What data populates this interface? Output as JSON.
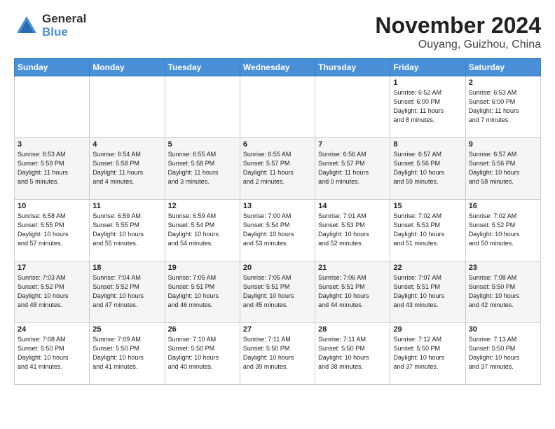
{
  "logo": {
    "general": "General",
    "blue": "Blue"
  },
  "title": "November 2024",
  "subtitle": "Ouyang, Guizhou, China",
  "header_days": [
    "Sunday",
    "Monday",
    "Tuesday",
    "Wednesday",
    "Thursday",
    "Friday",
    "Saturday"
  ],
  "weeks": [
    [
      {
        "day": "",
        "info": ""
      },
      {
        "day": "",
        "info": ""
      },
      {
        "day": "",
        "info": ""
      },
      {
        "day": "",
        "info": ""
      },
      {
        "day": "",
        "info": ""
      },
      {
        "day": "1",
        "info": "Sunrise: 6:52 AM\nSunset: 6:00 PM\nDaylight: 11 hours\nand 8 minutes."
      },
      {
        "day": "2",
        "info": "Sunrise: 6:53 AM\nSunset: 6:00 PM\nDaylight: 11 hours\nand 7 minutes."
      }
    ],
    [
      {
        "day": "3",
        "info": "Sunrise: 6:53 AM\nSunset: 5:59 PM\nDaylight: 11 hours\nand 5 minutes."
      },
      {
        "day": "4",
        "info": "Sunrise: 6:54 AM\nSunset: 5:58 PM\nDaylight: 11 hours\nand 4 minutes."
      },
      {
        "day": "5",
        "info": "Sunrise: 6:55 AM\nSunset: 5:58 PM\nDaylight: 11 hours\nand 3 minutes."
      },
      {
        "day": "6",
        "info": "Sunrise: 6:55 AM\nSunset: 5:57 PM\nDaylight: 11 hours\nand 2 minutes."
      },
      {
        "day": "7",
        "info": "Sunrise: 6:56 AM\nSunset: 5:57 PM\nDaylight: 11 hours\nand 0 minutes."
      },
      {
        "day": "8",
        "info": "Sunrise: 6:57 AM\nSunset: 5:56 PM\nDaylight: 10 hours\nand 59 minutes."
      },
      {
        "day": "9",
        "info": "Sunrise: 6:57 AM\nSunset: 5:56 PM\nDaylight: 10 hours\nand 58 minutes."
      }
    ],
    [
      {
        "day": "10",
        "info": "Sunrise: 6:58 AM\nSunset: 5:55 PM\nDaylight: 10 hours\nand 57 minutes."
      },
      {
        "day": "11",
        "info": "Sunrise: 6:59 AM\nSunset: 5:55 PM\nDaylight: 10 hours\nand 55 minutes."
      },
      {
        "day": "12",
        "info": "Sunrise: 6:59 AM\nSunset: 5:54 PM\nDaylight: 10 hours\nand 54 minutes."
      },
      {
        "day": "13",
        "info": "Sunrise: 7:00 AM\nSunset: 5:54 PM\nDaylight: 10 hours\nand 53 minutes."
      },
      {
        "day": "14",
        "info": "Sunrise: 7:01 AM\nSunset: 5:53 PM\nDaylight: 10 hours\nand 52 minutes."
      },
      {
        "day": "15",
        "info": "Sunrise: 7:02 AM\nSunset: 5:53 PM\nDaylight: 10 hours\nand 51 minutes."
      },
      {
        "day": "16",
        "info": "Sunrise: 7:02 AM\nSunset: 5:52 PM\nDaylight: 10 hours\nand 50 minutes."
      }
    ],
    [
      {
        "day": "17",
        "info": "Sunrise: 7:03 AM\nSunset: 5:52 PM\nDaylight: 10 hours\nand 48 minutes."
      },
      {
        "day": "18",
        "info": "Sunrise: 7:04 AM\nSunset: 5:52 PM\nDaylight: 10 hours\nand 47 minutes."
      },
      {
        "day": "19",
        "info": "Sunrise: 7:05 AM\nSunset: 5:51 PM\nDaylight: 10 hours\nand 46 minutes."
      },
      {
        "day": "20",
        "info": "Sunrise: 7:05 AM\nSunset: 5:51 PM\nDaylight: 10 hours\nand 45 minutes."
      },
      {
        "day": "21",
        "info": "Sunrise: 7:06 AM\nSunset: 5:51 PM\nDaylight: 10 hours\nand 44 minutes."
      },
      {
        "day": "22",
        "info": "Sunrise: 7:07 AM\nSunset: 5:51 PM\nDaylight: 10 hours\nand 43 minutes."
      },
      {
        "day": "23",
        "info": "Sunrise: 7:08 AM\nSunset: 5:50 PM\nDaylight: 10 hours\nand 42 minutes."
      }
    ],
    [
      {
        "day": "24",
        "info": "Sunrise: 7:08 AM\nSunset: 5:50 PM\nDaylight: 10 hours\nand 41 minutes."
      },
      {
        "day": "25",
        "info": "Sunrise: 7:09 AM\nSunset: 5:50 PM\nDaylight: 10 hours\nand 41 minutes."
      },
      {
        "day": "26",
        "info": "Sunrise: 7:10 AM\nSunset: 5:50 PM\nDaylight: 10 hours\nand 40 minutes."
      },
      {
        "day": "27",
        "info": "Sunrise: 7:11 AM\nSunset: 5:50 PM\nDaylight: 10 hours\nand 39 minutes."
      },
      {
        "day": "28",
        "info": "Sunrise: 7:11 AM\nSunset: 5:50 PM\nDaylight: 10 hours\nand 38 minutes."
      },
      {
        "day": "29",
        "info": "Sunrise: 7:12 AM\nSunset: 5:50 PM\nDaylight: 10 hours\nand 37 minutes."
      },
      {
        "day": "30",
        "info": "Sunrise: 7:13 AM\nSunset: 5:50 PM\nDaylight: 10 hours\nand 37 minutes."
      }
    ]
  ]
}
